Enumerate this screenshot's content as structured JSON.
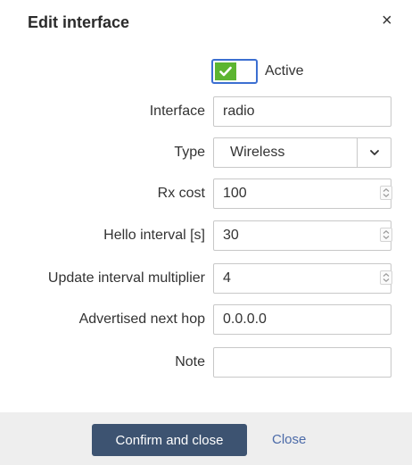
{
  "dialog": {
    "title": "Edit interface",
    "close_glyph": "×"
  },
  "active": {
    "label": "Active",
    "checked": true,
    "colors": {
      "on": "#5cb531",
      "focus": "#3c6fd1"
    }
  },
  "fields": {
    "interface": {
      "label": "Interface",
      "value": "radio"
    },
    "type": {
      "label": "Type",
      "value": "Wireless"
    },
    "rx_cost": {
      "label": "Rx cost",
      "value": "100"
    },
    "hello_interval": {
      "label": "Hello interval [s]",
      "value": "30"
    },
    "update_interval_multiplier": {
      "label": "Update interval multiplier",
      "value": "4"
    },
    "advertised_next_hop": {
      "label": "Advertised next hop",
      "value": "0.0.0.0"
    },
    "note": {
      "label": "Note",
      "value": ""
    }
  },
  "footer": {
    "confirm_label": "Confirm and close",
    "close_label": "Close",
    "colors": {
      "confirm_bg": "#3d5371",
      "close_text": "#4b6aa8",
      "footer_bg": "#eeeeee"
    }
  },
  "icons": {
    "close": "close-icon",
    "check": "check-icon",
    "chevron": "chevron-down-icon",
    "spinner": "spinner-icon"
  }
}
